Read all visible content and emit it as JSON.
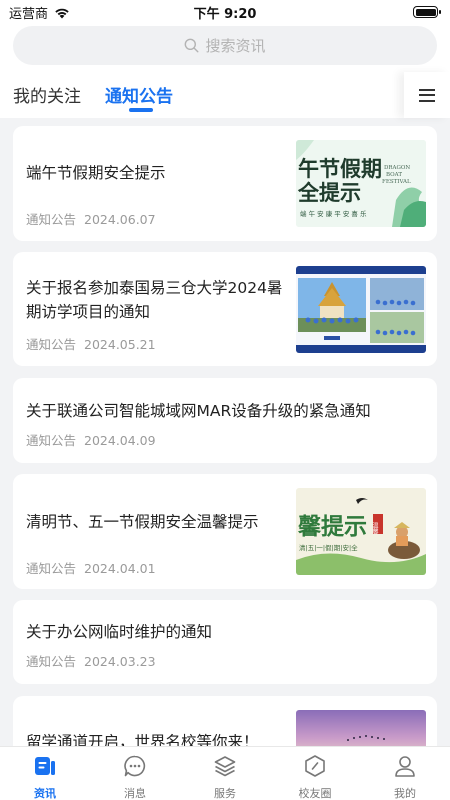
{
  "status_bar": {
    "carrier": "运营商",
    "time": "下午 9:20"
  },
  "search": {
    "placeholder": "搜索资讯"
  },
  "tabs": [
    {
      "label": "我的关注",
      "active": false
    },
    {
      "label": "通知公告",
      "active": true
    }
  ],
  "accent_color": "#1a72f0",
  "news": [
    {
      "title": "端午节假期安全提示",
      "category": "通知公告",
      "date": "2024.06.07",
      "thumb": {
        "kind": "dragon-boat",
        "big_text_1": "午节假期",
        "big_text_2": "全提示",
        "eng_1": "DRAGON",
        "eng_2": "BOAT",
        "eng_3": "FESTIVAL",
        "small_text": "端 午 安 康   平 安 喜 乐"
      }
    },
    {
      "title": "关于报名参加泰国易三仓大学2024暑期访学项目的通知",
      "category": "通知公告",
      "date": "2024.05.21",
      "thumb": {
        "kind": "photo-collage"
      }
    },
    {
      "title": "关于联通公司智能城域网MAR设备升级的紧急通知",
      "category": "通知公告",
      "date": "2024.04.09",
      "thumb": null
    },
    {
      "title": "清明节、五一节假期安全温馨提示",
      "category": "通知公告",
      "date": "2024.04.01",
      "thumb": {
        "kind": "qingming",
        "big_text": "馨提示",
        "seal_text": "温馨",
        "small_text": "清|五|一|假|期|安|全"
      }
    },
    {
      "title": "关于办公网临时维护的通知",
      "category": "通知公告",
      "date": "2024.03.23",
      "thumb": null
    },
    {
      "title": "留学通道开启，世界名校等你来！",
      "category": "",
      "date": "",
      "thumb": {
        "kind": "sunset"
      }
    }
  ],
  "bottom_nav": [
    {
      "label": "资讯",
      "icon": "news-icon",
      "active": true
    },
    {
      "label": "消息",
      "icon": "message-icon",
      "active": false
    },
    {
      "label": "服务",
      "icon": "service-layers-icon",
      "active": false
    },
    {
      "label": "校友圈",
      "icon": "alumni-compass-icon",
      "active": false
    },
    {
      "label": "我的",
      "icon": "profile-icon",
      "active": false
    }
  ]
}
